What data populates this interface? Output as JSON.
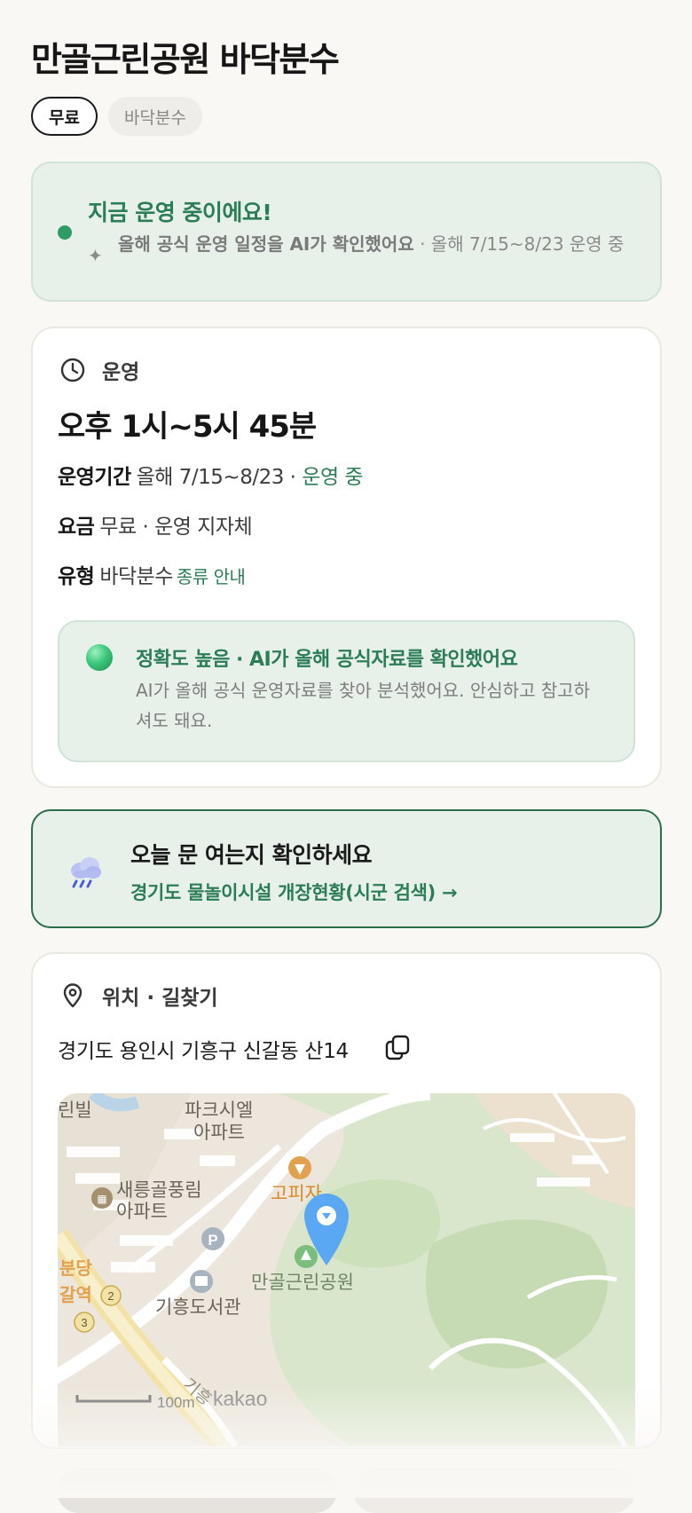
{
  "page": {
    "title": "만골근린공원 바닥분수",
    "chips": [
      "무료",
      "바닥분수"
    ]
  },
  "status_banner": {
    "headline": "지금 운영 중이에요!",
    "sub_bold": "올해 공식 운영 일정을 AI가 확인했어요",
    "sub_rest": " · 올해 7/15~8/23 운영 중",
    "accent_color": "#2b7d55"
  },
  "hours_card": {
    "section_label": "운영",
    "hours": "오후 1시~5시 45분",
    "period_label": "운영기간",
    "period_value": "올해 7/15~8/23 · ",
    "period_status": "운영 중",
    "fee_label": "요금",
    "fee_value": "무료 · 운영 지자체",
    "type_label": "유형",
    "type_value": "바닥분수",
    "type_link": "종류 안내",
    "accuracy_title": "정확도 높음 · AI가 올해 공식자료를 확인했어요",
    "accuracy_desc": "AI가 올해 공식 운영자료를 찾아 분석했어요. 안심하고 참고하셔도 돼요."
  },
  "cta": {
    "title": "오늘 문 여는지 확인하세요",
    "link": "경기도 물놀이시설 개장현황(시군 검색) →",
    "icon": "rain-cloud-icon"
  },
  "location_card": {
    "section_label": "위치 · 길찾기",
    "address": "경기도 용인시 기흥구 신갈동 산14",
    "map": {
      "labels": {
        "apt1": "파크시엘",
        "apt1b": "아파트",
        "apt2": "새릉골풍림",
        "apt2b": "아파트",
        "bldg": "린빌",
        "restaurant": "고피자",
        "park": "만골근린공원",
        "library": "기흥도서관",
        "station1": "분당",
        "station2": "갈역",
        "road": "기흥",
        "num2": "2",
        "num3": "3",
        "parking": "P"
      },
      "scale": "100m",
      "brand": "kakao"
    }
  }
}
